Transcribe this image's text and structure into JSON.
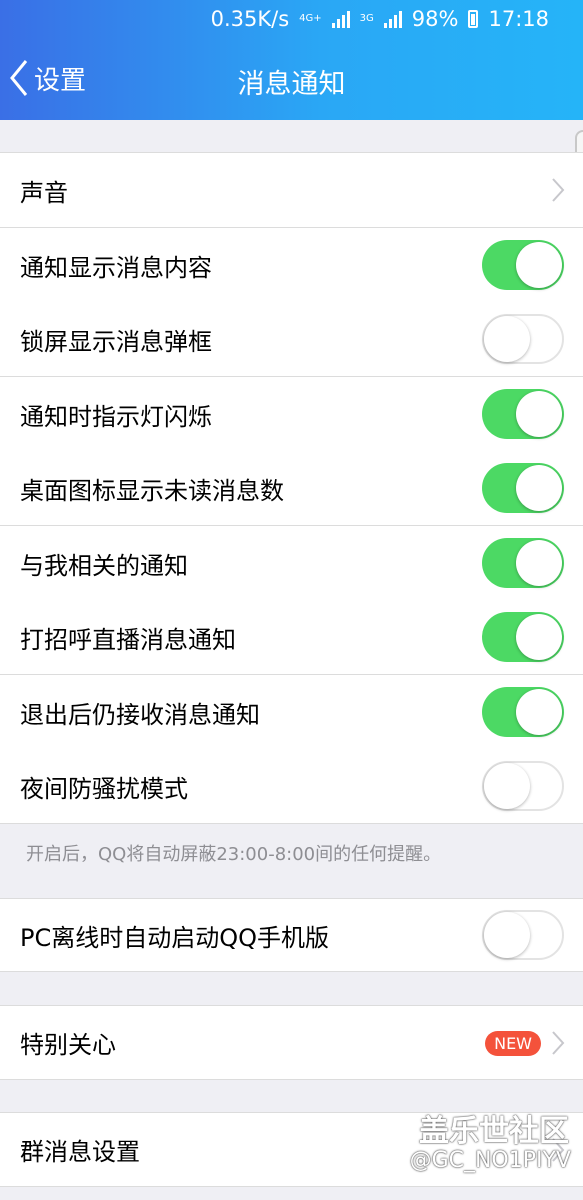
{
  "status_bar": {
    "speed": "0.35K/s",
    "network1": "4G+",
    "network2": "3G",
    "battery": "98%",
    "time": "17:18"
  },
  "nav": {
    "back_label": "设置",
    "title": "消息通知"
  },
  "settings": [
    {
      "label": "声音",
      "type": "chevron"
    },
    {
      "label": "通知显示消息内容",
      "type": "toggle",
      "on": true
    },
    {
      "label": "锁屏显示消息弹框",
      "type": "toggle",
      "on": false
    },
    {
      "label": "通知时指示灯闪烁",
      "type": "toggle",
      "on": true
    },
    {
      "label": "桌面图标显示未读消息数",
      "type": "toggle",
      "on": true
    },
    {
      "label": "与我相关的通知",
      "type": "toggle",
      "on": true
    },
    {
      "label": "打招呼直播消息通知",
      "type": "toggle",
      "on": true
    },
    {
      "label": "退出后仍接收消息通知",
      "type": "toggle",
      "on": true
    },
    {
      "label": "夜间防骚扰模式",
      "type": "toggle",
      "on": false
    }
  ],
  "night_mode_note": "开启后，QQ将自动屏蔽23:00-8:00间的任何提醒。",
  "pc_offline": {
    "label": "PC离线时自动启动QQ手机版",
    "on": false
  },
  "special_care": {
    "label": "特别关心",
    "badge": "NEW"
  },
  "group_settings": {
    "label": "群消息设置"
  },
  "watermark": {
    "line1": "盖乐世社区",
    "line2": "@GC_NO1PIYV"
  },
  "colors": {
    "toggle_on": "#4cd964",
    "badge": "#f4523b",
    "header_start": "#3a6fe6",
    "header_end": "#25b4f8"
  }
}
